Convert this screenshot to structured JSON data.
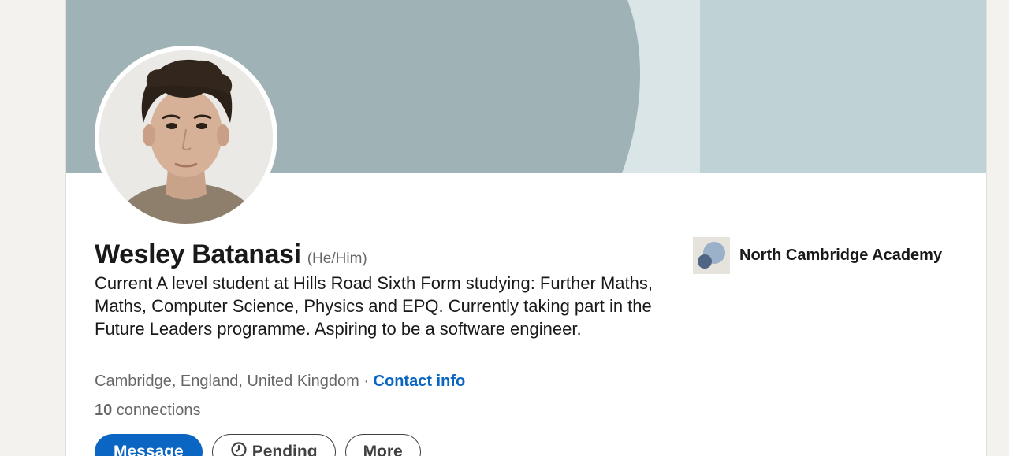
{
  "profile": {
    "name": "Wesley Batanasi",
    "pronouns": "(He/Him)",
    "headline": "Current A level student at Hills Road Sixth Form studying: Further Maths, Maths, Computer Science, Physics and EPQ. Currently taking part in the Future Leaders programme. Aspiring to be a software engineer.",
    "location": "Cambridge, England, United Kingdom",
    "separator": " · ",
    "contact_info_label": "Contact info",
    "connections_count": "10",
    "connections_label": " connections"
  },
  "organization": {
    "name": "North Cambridge Academy",
    "logo_icon": "overlapping-circles-logo"
  },
  "actions": {
    "message_label": "Message",
    "pending_label": "Pending",
    "pending_icon": "clock-icon",
    "more_label": "More"
  },
  "colors": {
    "brand_blue": "#0a66c2",
    "banner_dark": "#9fb3b7",
    "banner_light": "#bfd3d6",
    "banner_band": "#d9e5e7",
    "page_background": "#f4f2ee"
  }
}
